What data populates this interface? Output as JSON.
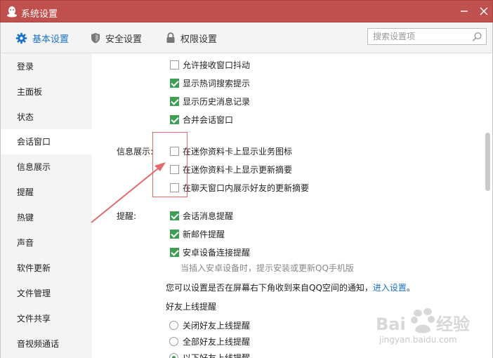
{
  "window": {
    "title": "系统设置",
    "brand_color": "#c0504d"
  },
  "tabs": [
    {
      "label": "基本设置",
      "icon": "gear-icon",
      "active": true
    },
    {
      "label": "安全设置",
      "icon": "shield-icon",
      "active": false
    },
    {
      "label": "权限设置",
      "icon": "lock-icon",
      "active": false
    }
  ],
  "search": {
    "placeholder": "搜索设置项",
    "value": ""
  },
  "sidebar": {
    "items": [
      {
        "label": "登录"
      },
      {
        "label": "主面板"
      },
      {
        "label": "状态"
      },
      {
        "label": "会话窗口",
        "active": true
      },
      {
        "label": "信息展示"
      },
      {
        "label": "提醒"
      },
      {
        "label": "热键"
      },
      {
        "label": "声音"
      },
      {
        "label": "软件更新"
      },
      {
        "label": "文件管理"
      },
      {
        "label": "文件共享"
      },
      {
        "label": "音视频通话"
      }
    ]
  },
  "session": {
    "options": [
      {
        "label": "允许接收窗口抖动",
        "checked": false
      },
      {
        "label": "显示热词搜索提示",
        "checked": true
      },
      {
        "label": "显示历史消息记录",
        "checked": true
      },
      {
        "label": "合并会话窗口",
        "checked": true
      }
    ]
  },
  "info_display": {
    "label": "信息展示:",
    "options": [
      {
        "label": "在迷你资料卡上显示业务图标",
        "checked": false
      },
      {
        "label": "在迷你资料卡上显示更新摘要",
        "checked": false
      },
      {
        "label": "在聊天窗口内展示好友的更新摘要",
        "checked": false
      }
    ]
  },
  "remind": {
    "label": "提醒:",
    "options": [
      {
        "label": "会话消息提醒",
        "checked": true
      },
      {
        "label": "新邮件提醒",
        "checked": true
      },
      {
        "label": "安卓设备连接提醒",
        "checked": true
      }
    ],
    "hint": "当插入安卓设备时，提示安装或更新QQ手机版",
    "notice_text": "您可以设置是否在屏幕右下角收到来自QQ空间的通知，",
    "notice_link": "进入设置",
    "notice_end": "。"
  },
  "friend_online": {
    "heading": "好友上线提醒",
    "options": [
      {
        "label": "关闭好友上线提醒",
        "selected": false
      },
      {
        "label": "全部好友上线提醒",
        "selected": false
      },
      {
        "label": "以下好友上线提醒",
        "selected": true
      }
    ]
  },
  "watermark": {
    "text": "jingyan.baidu.com"
  },
  "accent_colors": {
    "check_green": "#3e9f54",
    "link_blue": "#1a73c8",
    "annotation_red": "#e26a6a"
  }
}
